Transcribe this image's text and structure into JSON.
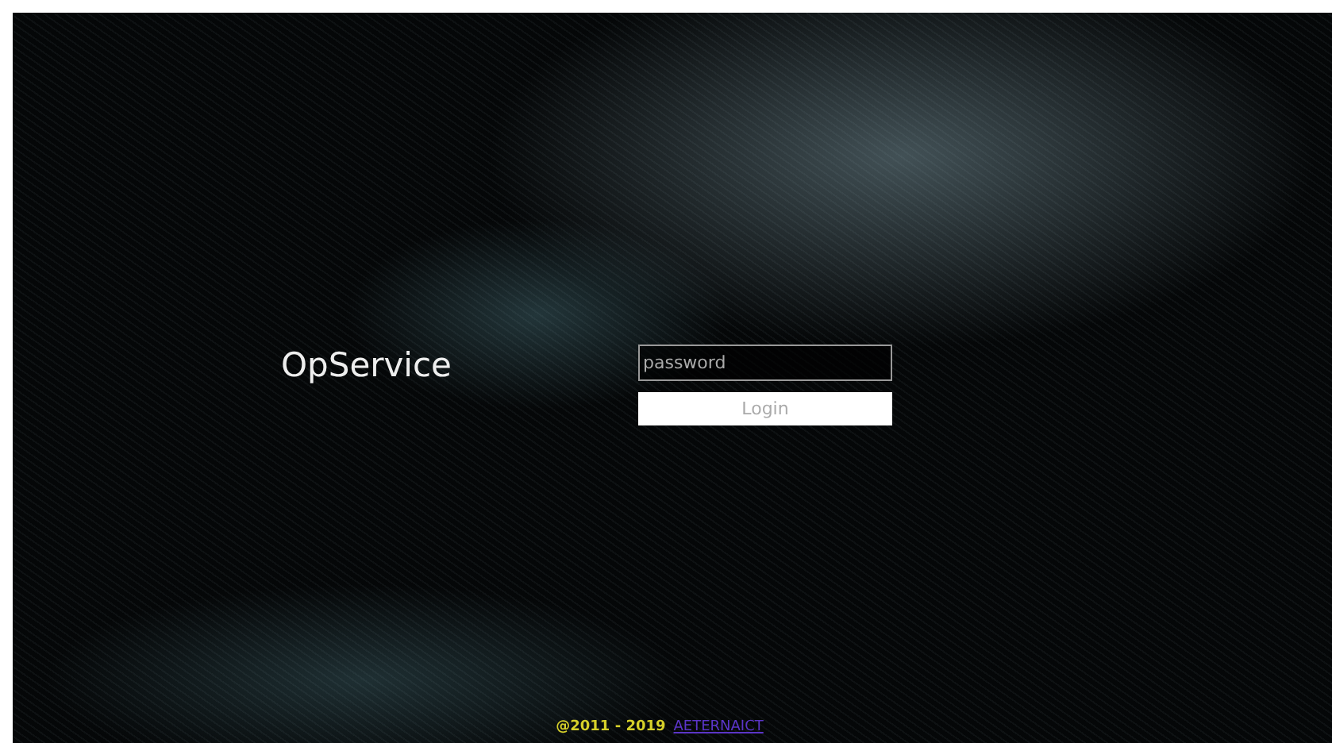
{
  "app_title": "OpService",
  "password_field": {
    "placeholder": "password"
  },
  "login_button": {
    "label": "Login"
  },
  "footer": {
    "copyright": "@2011 - 2019",
    "link": "AETERNAICT"
  }
}
